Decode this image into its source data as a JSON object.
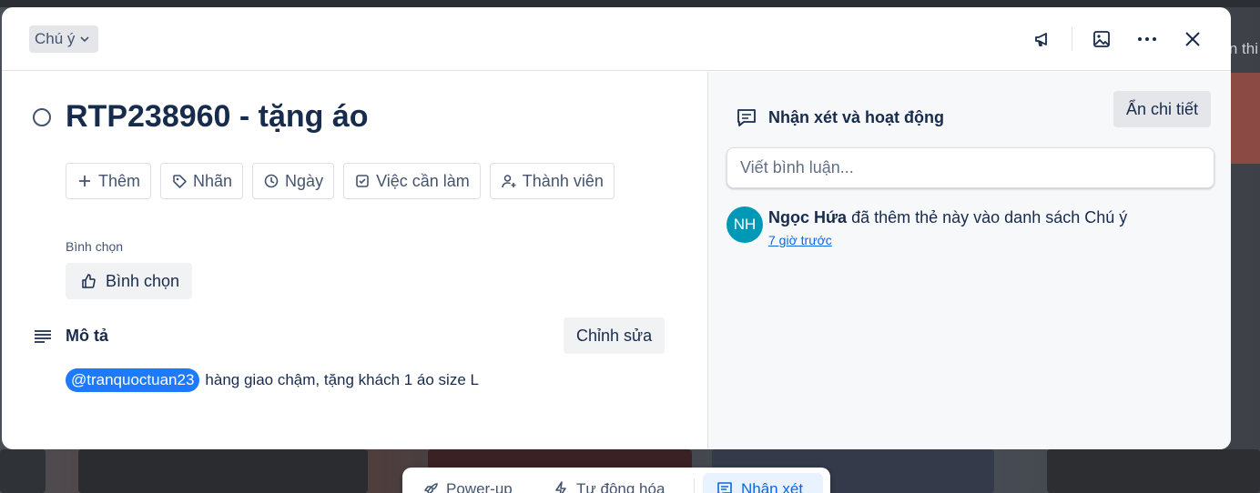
{
  "header": {
    "list_chip": "Chú ý"
  },
  "card": {
    "title": "RTP238960 - tặng áo",
    "actions": [
      {
        "label": "Thêm",
        "icon": "plus-icon"
      },
      {
        "label": "Nhãn",
        "icon": "tag-icon"
      },
      {
        "label": "Ngày",
        "icon": "clock-icon"
      },
      {
        "label": "Việc cần làm",
        "icon": "checkbox-icon"
      },
      {
        "label": "Thành viên",
        "icon": "add-user-icon"
      }
    ],
    "vote": {
      "label": "Bình chọn",
      "button": "Bình chọn"
    },
    "description": {
      "title": "Mô tả",
      "edit_button": "Chỉnh sửa",
      "mention": "@tranquoctuan23",
      "text": "hàng giao chậm, tặng khách 1 áo size L"
    }
  },
  "activity": {
    "title": "Nhận xét và hoạt động",
    "hide_button": "Ẩn chi tiết",
    "comment_placeholder": "Viết bình luận...",
    "item": {
      "avatar_initials": "NH",
      "user": "Ngọc Hứa",
      "action": "đã thêm thẻ này vào danh sách Chú ý",
      "time": "7 giờ trước"
    }
  },
  "bottom_bar": {
    "power_ups": "Power-up",
    "automation": "Tự động hóa",
    "comments": "Nhận xét"
  },
  "background": {
    "right_text": "n thi"
  },
  "colors": {
    "mention": "#1d7afc",
    "avatar": "#0098b7",
    "link": "#0c66e4"
  }
}
